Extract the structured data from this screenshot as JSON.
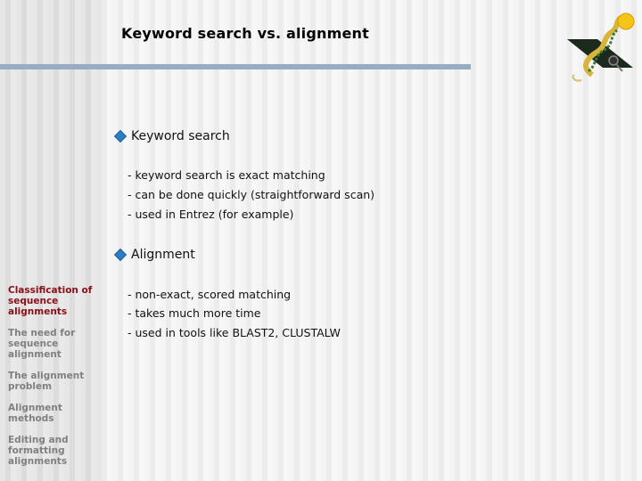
{
  "slide": {
    "title": "Keyword search vs. alignment",
    "accent_color": "#98adc4",
    "bullet_color": "#2a7fc4"
  },
  "content": {
    "sections": [
      {
        "heading": "Keyword search",
        "items": [
          "- keyword search is exact matching",
          "- can be done quickly (straightforward scan)",
          "- used in Entrez (for example)"
        ]
      },
      {
        "heading": "Alignment",
        "items": [
          "- non-exact, scored matching",
          "- takes much more time",
          "- used in tools like BLAST2, CLUSTALW"
        ]
      }
    ]
  },
  "sidebar": {
    "active_color": "#8b0f16",
    "inactive_color": "#808080",
    "items": [
      {
        "label": "Classification of sequence alignments",
        "active": true
      },
      {
        "label": "The need for sequence alignment",
        "active": false
      },
      {
        "label": "The alignment problem",
        "active": false
      },
      {
        "label": "Alignment methods",
        "active": false
      },
      {
        "label": "Editing and formatting alignments",
        "active": false
      }
    ]
  },
  "logo": {
    "icon": "dna-helix-magnifier-logo"
  }
}
